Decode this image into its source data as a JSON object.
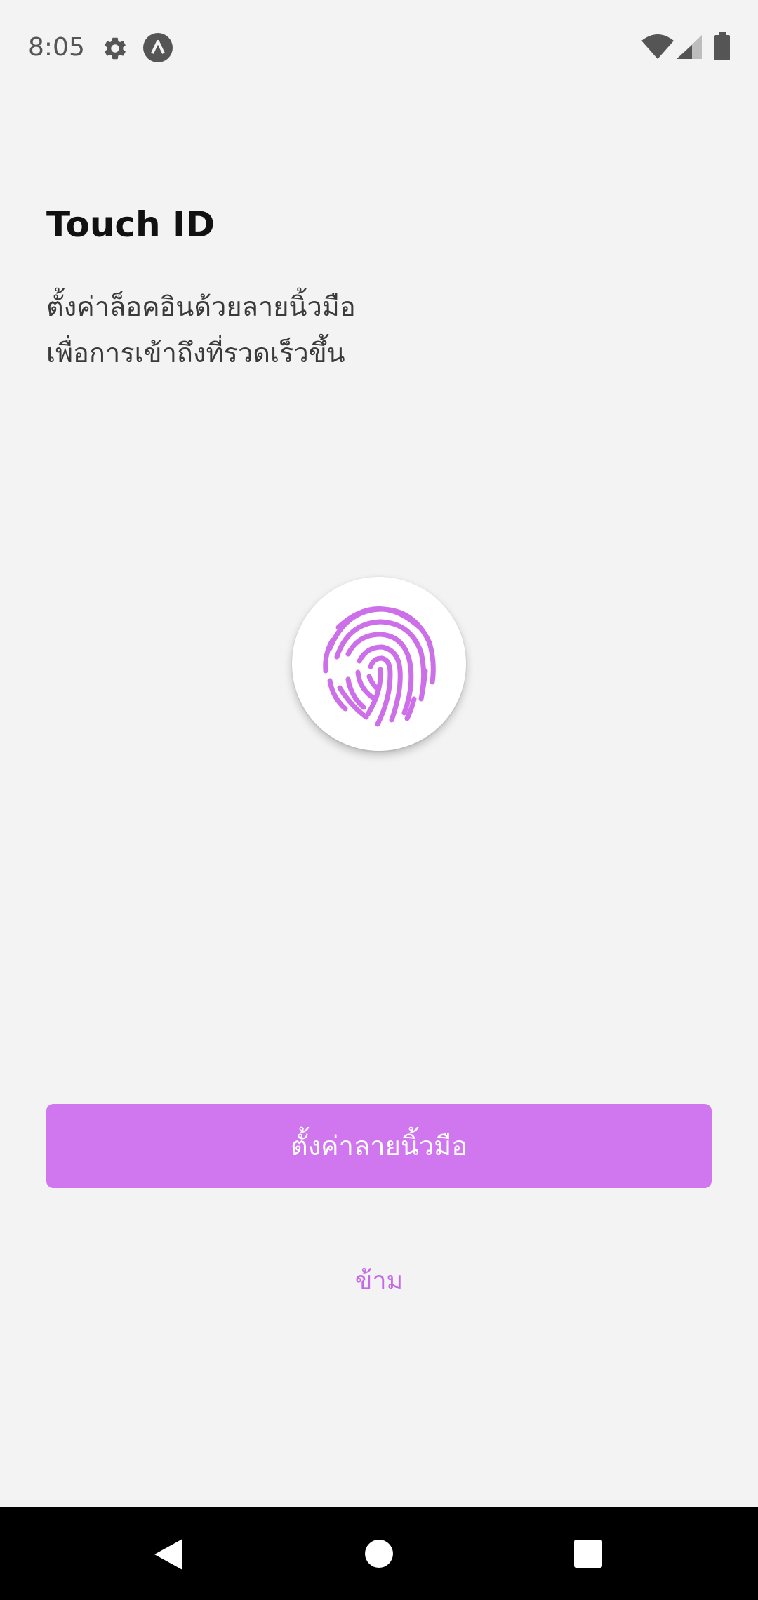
{
  "status_bar": {
    "time": "8:05",
    "icons": [
      "gear-icon",
      "a-circle-icon",
      "wifi-icon",
      "signal-icon",
      "battery-icon"
    ]
  },
  "main": {
    "title": "Touch ID",
    "subtitle_lines": [
      "ตั้งค่าล็อคอินด้วยลายนิ้วมือ",
      "เพื่อการเข้าถึงที่รวดเร็วขึ้น"
    ],
    "fingerprint_icon": "fingerprint-icon",
    "setup_button_label": "ตั้งค่าลายนิ้วมือ",
    "skip_label": "ข้าม"
  },
  "nav_bar": {
    "buttons": [
      "back-icon",
      "home-icon",
      "recents-icon"
    ]
  },
  "colors": {
    "accent": "#d077f0",
    "fingerprint": "#cc6fe8",
    "background": "#f3f3f3"
  }
}
